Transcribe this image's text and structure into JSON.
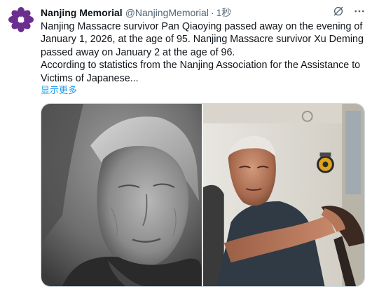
{
  "tweet": {
    "author": {
      "display_name": "Nanjing Memorial",
      "handle": "@NanjingMemorial",
      "avatar_icon": "purple-flower-logo-icon"
    },
    "separator": "·",
    "time": "1秒",
    "body": {
      "para1": "Nanjing Massacre survivor Pan Qiaoying passed away on the evening of January 1, 2026, at the age of 95. Nanjing Massacre survivor Xu Deming passed away on January 2 at the age of 96.",
      "para2": "According to statistics from the Nanjing Association for the Assistance to Victims of Japanese..."
    },
    "show_more": "显示更多",
    "actions": {
      "grok_icon": "grok-icon",
      "more_icon": "more-dots-icon"
    },
    "media": [
      {
        "name": "photo-elderly-woman",
        "style": "black-and-white"
      },
      {
        "name": "photo-elderly-man",
        "style": "color"
      }
    ],
    "colors": {
      "brand_purple": "#6b2e8f",
      "link_blue": "#1d9bf0",
      "secondary_text": "#536471",
      "primary_text": "#0f1419"
    }
  }
}
